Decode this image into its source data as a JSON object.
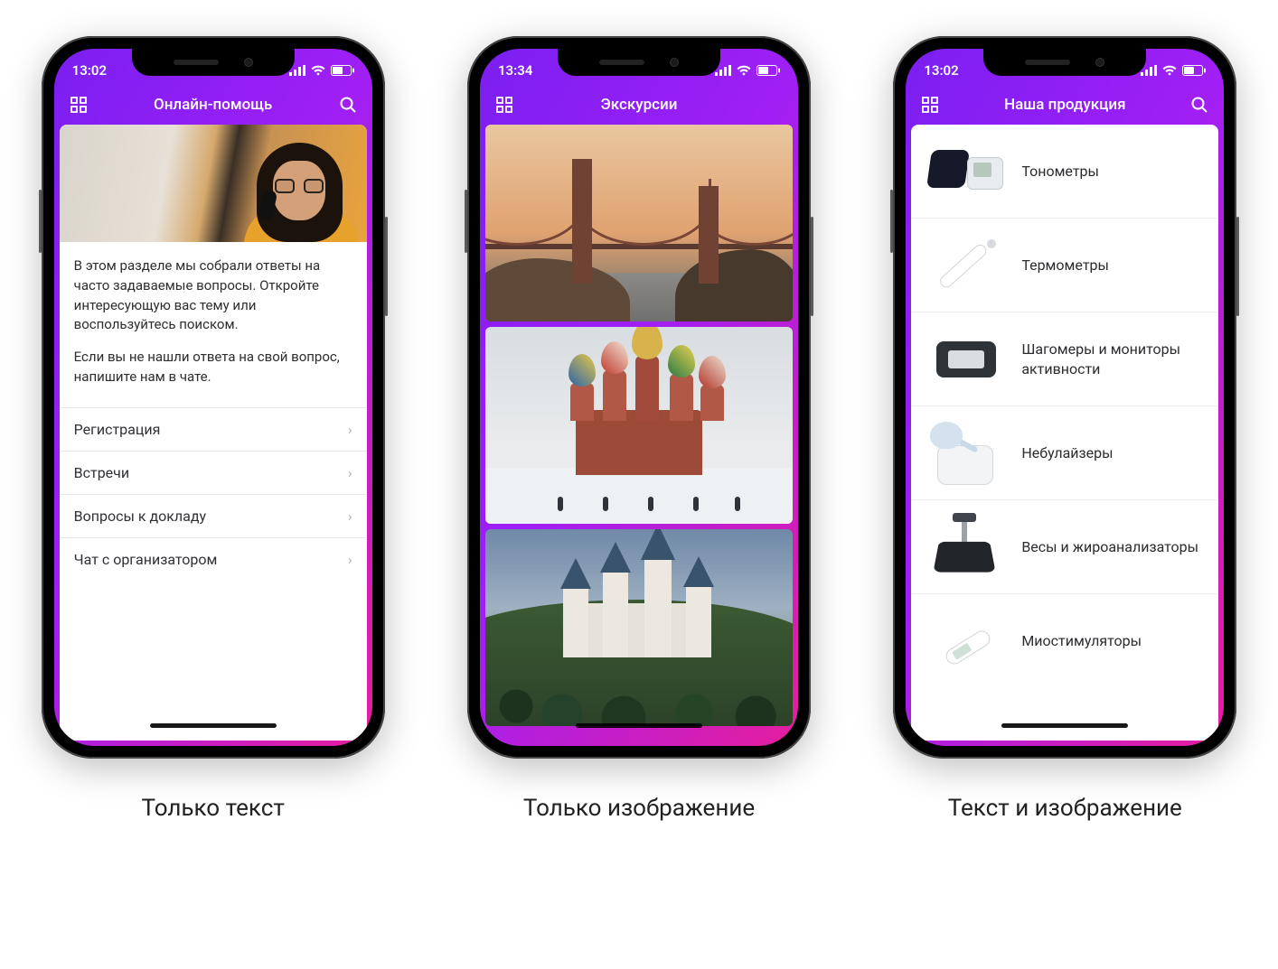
{
  "captions": {
    "col1": "Только текст",
    "col2": "Только изображение",
    "col3": "Текст и изображение"
  },
  "phone1": {
    "status": {
      "time": "13:02"
    },
    "nav": {
      "title": "Онлайн-помощь"
    },
    "intro": {
      "p1": "В этом разделе мы собрали ответы на часто задаваемые вопросы. Откройте интересующую вас тему или воспользуйтесь поиском.",
      "p2": "Если вы не нашли ответа на свой вопрос, напишите нам в чате."
    },
    "items": [
      {
        "label": "Регистрация"
      },
      {
        "label": "Встречи"
      },
      {
        "label": "Вопросы к докладу"
      },
      {
        "label": "Чат с организатором"
      }
    ]
  },
  "phone2": {
    "status": {
      "time": "13:34"
    },
    "nav": {
      "title": "Экскурсии"
    },
    "tiles": [
      {
        "name": "golden-gate-bridge"
      },
      {
        "name": "st-basils-cathedral"
      },
      {
        "name": "neuschwanstein-castle"
      }
    ]
  },
  "phone3": {
    "status": {
      "time": "13:02"
    },
    "nav": {
      "title": "Наша продукция"
    },
    "products": [
      {
        "label": "Тонометры"
      },
      {
        "label": "Термометры"
      },
      {
        "label": "Шагомеры и мониторы активности"
      },
      {
        "label": "Небулайзеры"
      },
      {
        "label": "Весы и жироанализаторы"
      },
      {
        "label": "Миостимуляторы"
      }
    ]
  }
}
